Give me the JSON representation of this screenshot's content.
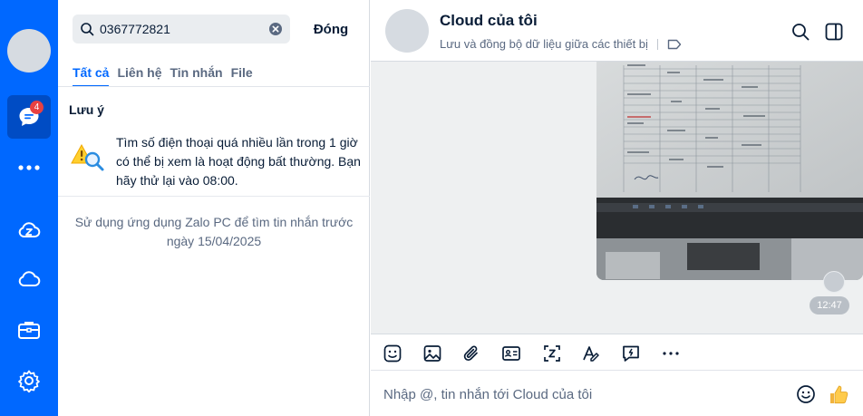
{
  "rail": {
    "chat_badge": "4"
  },
  "search": {
    "query": "0367772821",
    "close_label": "Đóng",
    "tabs": [
      {
        "label": "Tất cả"
      },
      {
        "label": "Liên hệ"
      },
      {
        "label": "Tin nhắn"
      },
      {
        "label": "File"
      }
    ],
    "note_title": "Lưu ý",
    "warning_text": "Tìm số điện thoại quá nhiều lần trong 1 giờ có thể bị xem là hoạt động bất thường. Bạn hãy thử lại vào 08:00.",
    "pc_text": "Sử dụng ứng dụng Zalo PC để tìm tin nhắn trước ngày 15/04/2025"
  },
  "chat": {
    "title": "Cloud của tôi",
    "subtitle": "Lưu và đồng bộ dữ liệu giữa các thiết bị",
    "message_time": "12:47",
    "composer_placeholder": "Nhập @, tin nhắn tới Cloud của tôi"
  },
  "colors": {
    "rail": "#0068ff",
    "accent": "#0068ff",
    "badge": "#e84142"
  }
}
